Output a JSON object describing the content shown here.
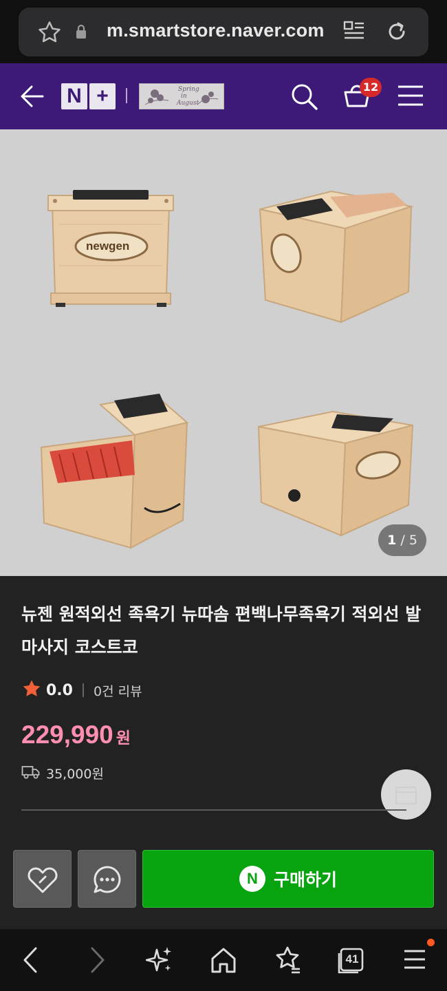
{
  "browser": {
    "url": "m.smartstore.naver.com",
    "tab_count": "41"
  },
  "header": {
    "brand_tiles": [
      "N",
      "+"
    ],
    "cart_count": "12",
    "store_logo_lines": [
      "Spring",
      "in",
      "August"
    ]
  },
  "gallery": {
    "current": "1",
    "separator": " / ",
    "total": "5",
    "brand_on_product": "newgen"
  },
  "product": {
    "title": "뉴젠 원적외선 족욕기 뉴따솜 편백나무족욕기 적외선 발마사지 코스트코",
    "rating": "0.0",
    "reviews": "0건 리뷰",
    "price": "229,990",
    "currency": "원",
    "shipping_fee": "35,000원"
  },
  "actions": {
    "buy_label": "구매하기",
    "buy_logo": "N"
  },
  "colors": {
    "nav_purple": "#3e1a78",
    "price_pink": "#ff8fb0",
    "buy_green": "#07a410",
    "badge_red": "#d62a2a",
    "star_orange": "#f2603a"
  }
}
